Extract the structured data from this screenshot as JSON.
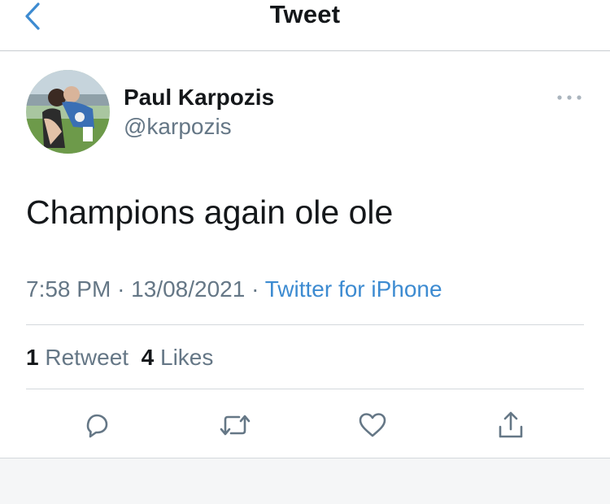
{
  "header": {
    "title": "Tweet",
    "back_icon": "chevron-left-icon"
  },
  "author": {
    "name": "Paul Karpozis",
    "handle": "@karpozis"
  },
  "tweet": {
    "text": "Champions again ole ole",
    "time": "7:58 PM",
    "date": "13/08/2021",
    "separator": "·",
    "source": "Twitter for iPhone"
  },
  "stats": {
    "retweets_count": "1",
    "retweets_label": "Retweet",
    "likes_count": "4",
    "likes_label": "Likes"
  },
  "actions": {
    "reply": "reply-icon",
    "retweet": "retweet-icon",
    "like": "heart-icon",
    "share": "share-icon"
  },
  "colors": {
    "accent": "#3d8bd1",
    "text_primary": "#14171a",
    "text_secondary": "#657786",
    "icon": "#657786",
    "divider": "#d4d8dc"
  }
}
